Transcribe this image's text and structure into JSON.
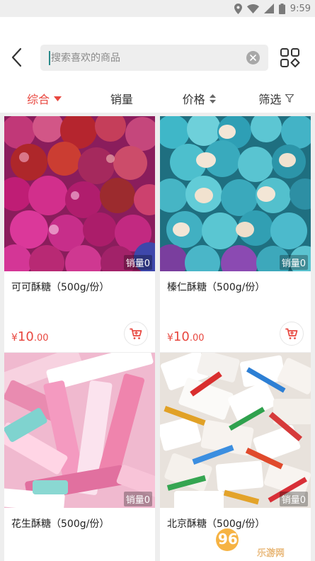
{
  "status": {
    "time": "9:59"
  },
  "search": {
    "placeholder": "搜索喜欢的商品"
  },
  "sort_tabs": [
    {
      "label": "综合"
    },
    {
      "label": "销量"
    },
    {
      "label": "价格"
    },
    {
      "label": "筛选"
    }
  ],
  "products": [
    {
      "title": "可可酥糖（500g/份）",
      "currency": "¥",
      "price_int": "10",
      "price_dec": ".00",
      "sales": "销量0",
      "image": "red-purple-wrapped-candy"
    },
    {
      "title": "榛仁酥糖（500g/份）",
      "currency": "¥",
      "price_int": "10",
      "price_dec": ".00",
      "sales": "销量0",
      "image": "teal-wrapped-candy"
    },
    {
      "title": "花生酥糖（500g/份）",
      "currency": "¥",
      "sales": "销量0",
      "image": "pink-stick-candy"
    },
    {
      "title": "北京酥糖（500g/份）",
      "currency": "¥",
      "sales": "销量0",
      "image": "white-colorful-wrapped-candy"
    }
  ],
  "watermark": {
    "line1": "962.NET",
    "line2": "乐游网"
  },
  "colors": {
    "accent": "#e8473f",
    "background": "#eeeeee"
  }
}
